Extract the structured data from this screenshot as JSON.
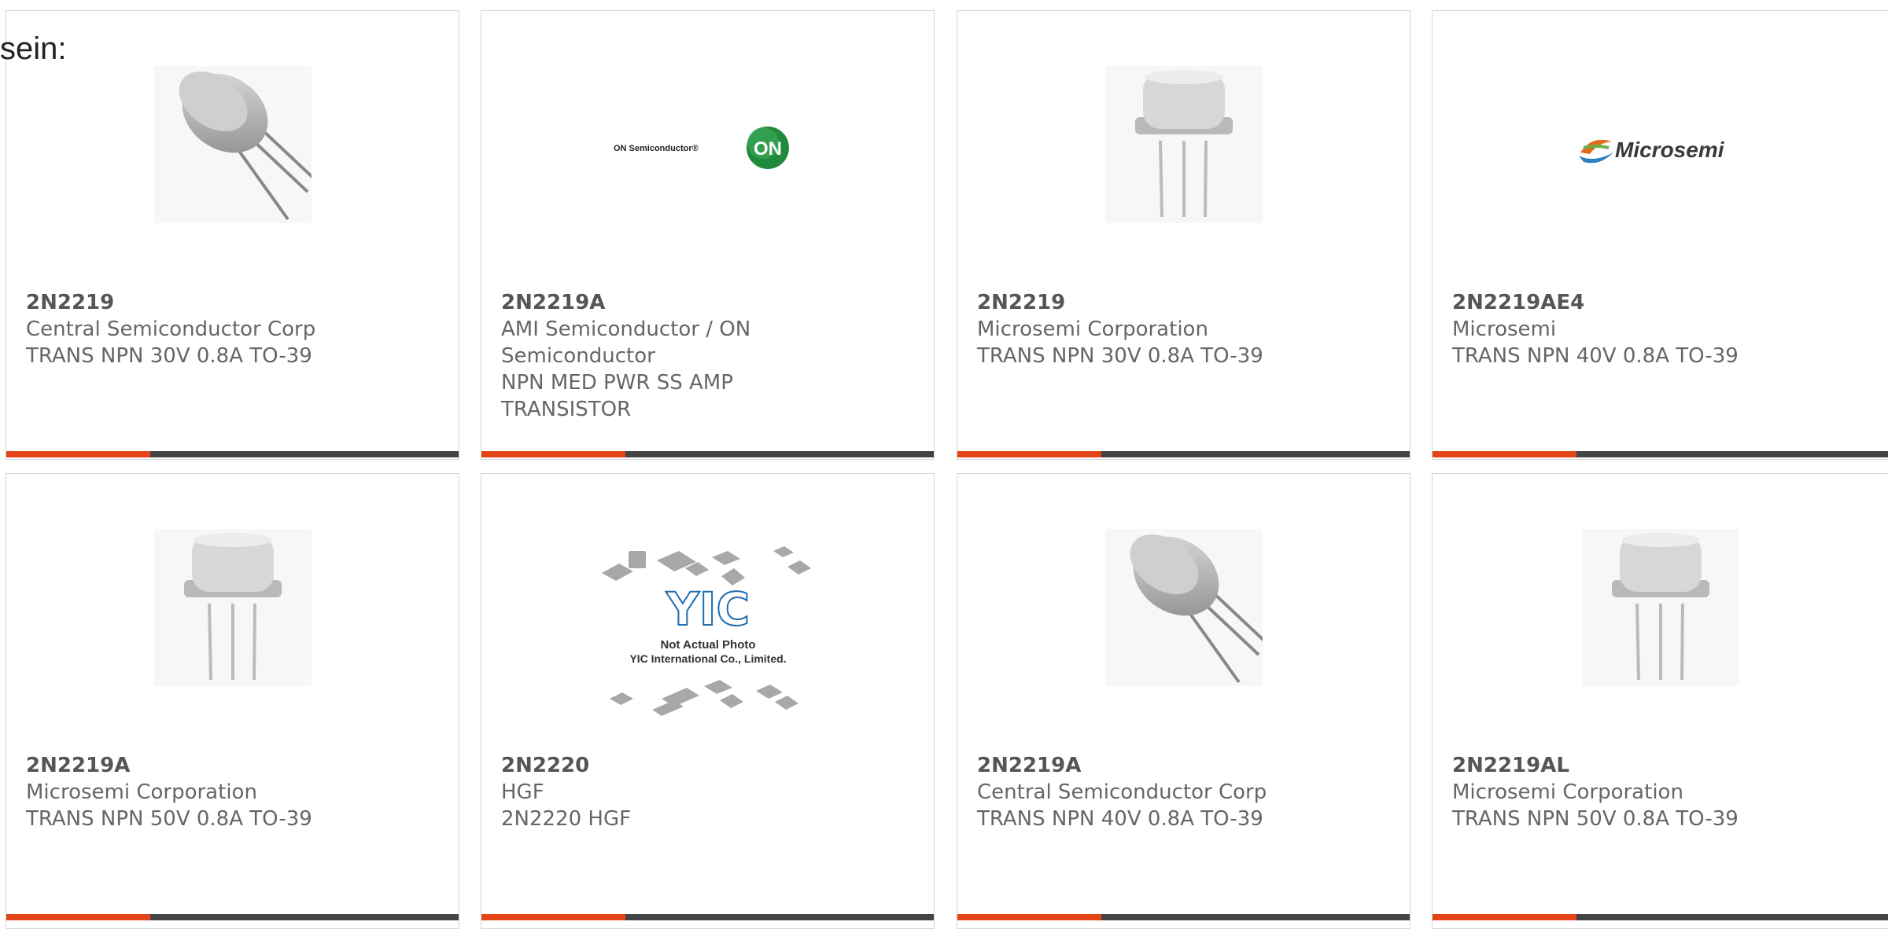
{
  "intro_text": "sein:",
  "colors": {
    "accent": "#e34418",
    "bar": "#444444",
    "text": "#666666"
  },
  "cards": [
    {
      "part": "2N2219",
      "manufacturer": "Central Semiconductor Corp",
      "description": "TRANS NPN 30V 0.8A TO-39",
      "image": "to39-angled-transistor"
    },
    {
      "part": "2N2219A",
      "manufacturer": "AMI Semiconductor / ON Semiconductor",
      "description": "NPN MED PWR SS AMP TRANSISTOR",
      "image": "on-semiconductor-logo",
      "logo_text": "ON Semiconductor®",
      "logo_badge": "ON"
    },
    {
      "part": "2N2219",
      "manufacturer": "Microsemi Corporation",
      "description": "TRANS NPN 30V 0.8A TO-39",
      "image": "to39-upright-transistor"
    },
    {
      "part": "2N2219AE4",
      "manufacturer": "Microsemi",
      "description": "TRANS NPN 40V 0.8A TO-39",
      "image": "microsemi-logo",
      "logo_text": "Microsemi"
    },
    {
      "part": "2N2219A",
      "manufacturer": "Microsemi Corporation",
      "description": "TRANS NPN 50V 0.8A TO-39",
      "image": "to39-upright-transistor"
    },
    {
      "part": "2N2220",
      "manufacturer": "HGF",
      "description": "2N2220 HGF",
      "image": "yic-placeholder",
      "placeholder_lines": [
        "Not Actual Photo",
        "YIC International Co., Limited."
      ]
    },
    {
      "part": "2N2219A",
      "manufacturer": "Central Semiconductor Corp",
      "description": "TRANS NPN 40V 0.8A TO-39",
      "image": "to39-angled-transistor"
    },
    {
      "part": "2N2219AL",
      "manufacturer": "Microsemi Corporation",
      "description": "TRANS NPN 50V 0.8A TO-39",
      "image": "to39-upright-transistor"
    }
  ]
}
